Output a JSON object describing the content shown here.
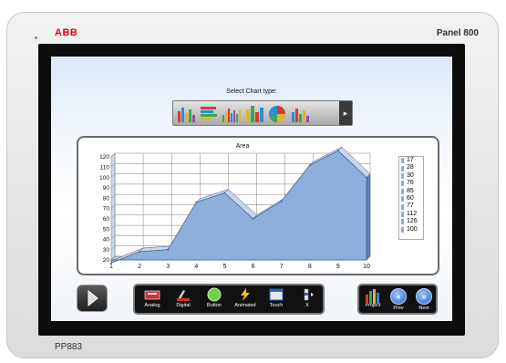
{
  "device": {
    "brand": "ABB",
    "model_name": "Panel 800",
    "model_code": "PP883"
  },
  "screen": {
    "select_label": "Select Chart type:",
    "chart_type_icons": [
      "bar-chart-icon",
      "stacked-bar-icon",
      "column-chart-icon",
      "tall-column-icon",
      "pie-chart-icon",
      "small-bar-icon"
    ],
    "toolbar": [
      {
        "label": "Analog",
        "icon": "analog-icon"
      },
      {
        "label": "Digital",
        "icon": "digital-icon"
      },
      {
        "label": "Button",
        "icon": "button-icon"
      },
      {
        "label": "Animated",
        "icon": "animated-icon"
      },
      {
        "label": "Touch",
        "icon": "touch-icon"
      },
      {
        "label": "X",
        "icon": "x-icon"
      }
    ],
    "nav": [
      {
        "label": "Project",
        "icon": "project-icon"
      },
      {
        "label": "Prev",
        "icon": "prev-icon"
      },
      {
        "label": "Next",
        "icon": "next-icon"
      }
    ]
  },
  "chart_data": {
    "type": "area",
    "title": "Area",
    "x": [
      1,
      2,
      3,
      4,
      5,
      6,
      7,
      8,
      9,
      10
    ],
    "values": [
      17,
      28,
      30,
      76,
      85,
      60,
      77,
      112,
      126,
      100
    ],
    "xlim": [
      1,
      10
    ],
    "ylim": [
      20,
      120
    ],
    "yticks": [
      20,
      30,
      40,
      50,
      60,
      70,
      80,
      90,
      100,
      110,
      120
    ],
    "grid": true,
    "legend_values": [
      "17",
      "28",
      "30",
      "76",
      "85",
      "60",
      "77",
      "112",
      "126",
      "100"
    ],
    "colors": {
      "fill": "#8eaedc",
      "edge": "#3b5b8f",
      "top": "#c6d6ee"
    }
  }
}
